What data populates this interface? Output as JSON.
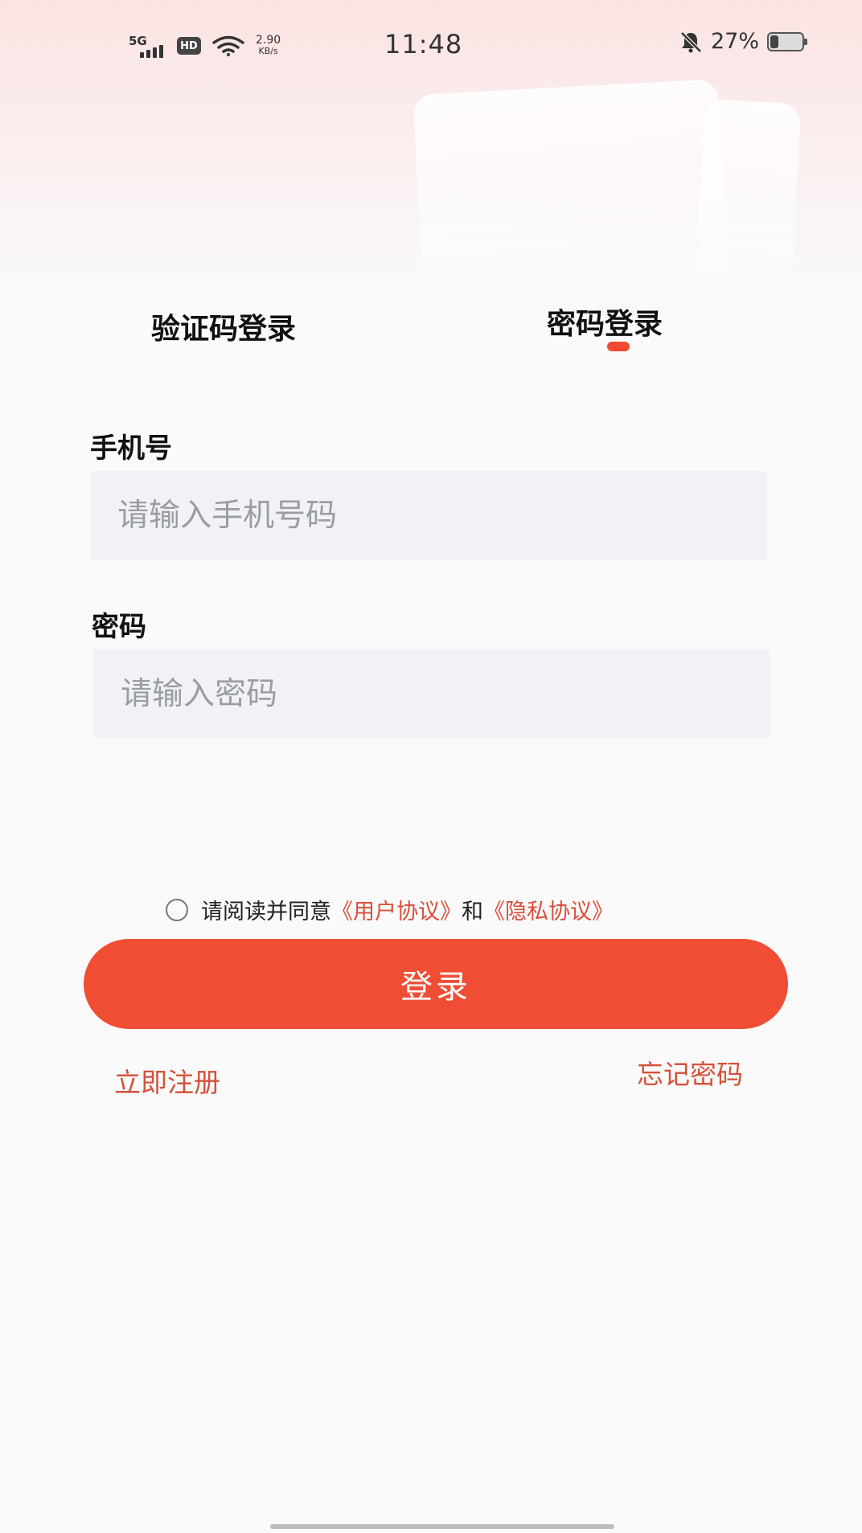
{
  "status_bar": {
    "network": "5G",
    "hd": "HD",
    "speed_value": "2.90",
    "speed_unit": "KB/s",
    "time": "11:48",
    "battery_pct": "27%",
    "battery_level": 0.27
  },
  "tabs": [
    {
      "label": "验证码登录",
      "active": false
    },
    {
      "label": "密码登录",
      "active": true
    }
  ],
  "form": {
    "phone_label": "手机号",
    "phone_placeholder": "请输入手机号码",
    "password_label": "密码",
    "password_placeholder": "请输入密码"
  },
  "agreement": {
    "prefix": "请阅读并同意",
    "user_agreement": "《用户协议》",
    "and": "和",
    "privacy_policy": "《隐私协议》"
  },
  "login_button": "登录",
  "links": {
    "register": "立即注册",
    "forgot": "忘记密码"
  },
  "colors": {
    "accent": "#f04e34",
    "link": "#d3523c",
    "input_bg": "#f0f2f6"
  }
}
